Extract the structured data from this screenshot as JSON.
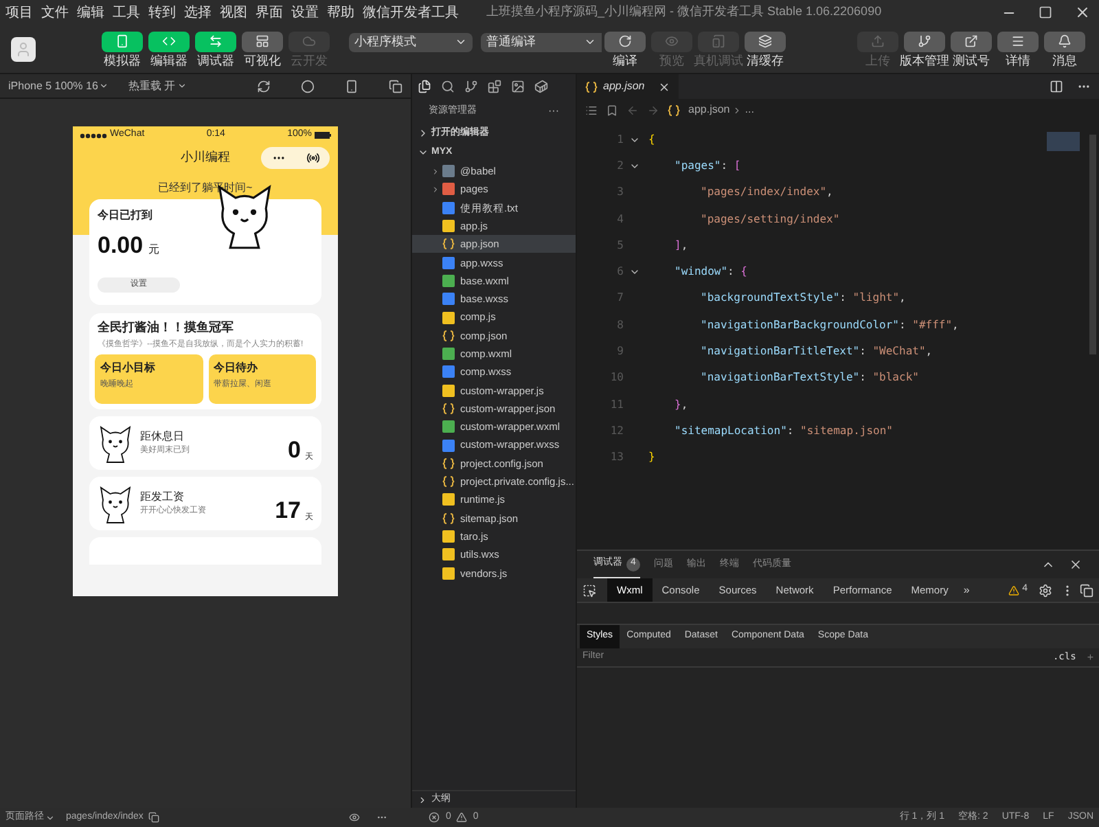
{
  "menu": [
    "项目",
    "文件",
    "编辑",
    "工具",
    "转到",
    "选择",
    "视图",
    "界面",
    "设置",
    "帮助",
    "微信开发者工具"
  ],
  "window": {
    "title": "上班摸鱼小程序源码_小川编程网 - 微信开发者工具 Stable 1.06.2206090"
  },
  "toolbar": {
    "view_buttons": [
      {
        "kind": "phone",
        "label": "模拟器",
        "selected": true,
        "disabled": false
      },
      {
        "kind": "code",
        "label": "编辑器",
        "selected": true,
        "disabled": false
      },
      {
        "kind": "debug",
        "label": "调试器",
        "selected": true,
        "disabled": false
      },
      {
        "kind": "layout",
        "label": "可视化",
        "selected": false,
        "disabled": false
      },
      {
        "kind": "cloud",
        "label": "云开发",
        "selected": false,
        "disabled": true
      }
    ],
    "mode_select": "小程序模式",
    "compile_select": "普通编译",
    "compile_buttons": [
      {
        "kind": "refresh",
        "label": "编译",
        "disabled": false
      },
      {
        "kind": "eye",
        "label": "预览",
        "disabled": true
      },
      {
        "kind": "device",
        "label": "真机调试",
        "disabled": true
      },
      {
        "kind": "layers",
        "label": "清缓存",
        "disabled": false
      }
    ],
    "right_buttons": [
      {
        "kind": "upload",
        "label": "上传",
        "disabled": true
      },
      {
        "kind": "branch",
        "label": "版本管理",
        "disabled": false
      },
      {
        "kind": "external",
        "label": "测试号",
        "disabled": false
      },
      {
        "kind": "menu",
        "label": "详情",
        "disabled": false
      },
      {
        "kind": "bell",
        "label": "消息",
        "disabled": false
      }
    ]
  },
  "simulator": {
    "device": "iPhone 5 100% 16",
    "hot_reload": "热重载 开",
    "phone": {
      "carrier": "WeChat",
      "time": "0:14",
      "battery": "100%",
      "nav_title": "小川编程",
      "banner": "已经到了躺平时间~",
      "earnings": {
        "title": "今日已打到",
        "amount": "0.00",
        "unit": "元",
        "button": "设置"
      },
      "motto": {
        "title": "全民打酱油！！摸鱼冠军",
        "quote": "《摸鱼哲学》--摸鱼不是自我放纵，而是个人实力的积蓄!"
      },
      "goals": [
        {
          "title": "今日小目标",
          "text": "晚睡晚起"
        },
        {
          "title": "今日待办",
          "text": "带薪拉屎、闲逛"
        }
      ],
      "countdowns": [
        {
          "title": "距休息日",
          "subtitle": "美好周末已到",
          "value": "0",
          "unit": "天"
        },
        {
          "title": "距发工资",
          "subtitle": "开开心心快发工资",
          "value": "17",
          "unit": "天"
        }
      ]
    }
  },
  "explorer": {
    "title": "资源管理器",
    "more": "···",
    "sections": [
      {
        "label": "打开的编辑器",
        "expanded": false
      },
      {
        "label": "MYX",
        "expanded": true
      }
    ],
    "files": [
      {
        "kind": "folder",
        "name": "@babel",
        "selected": false
      },
      {
        "kind": "pages",
        "name": "pages",
        "selected": false
      },
      {
        "kind": "txt",
        "name": "使用教程.txt",
        "selected": false
      },
      {
        "kind": "js",
        "name": "app.js",
        "selected": false
      },
      {
        "kind": "json",
        "name": "app.json",
        "selected": true
      },
      {
        "kind": "wxss",
        "name": "app.wxss",
        "selected": false
      },
      {
        "kind": "wxml",
        "name": "base.wxml",
        "selected": false
      },
      {
        "kind": "wxss",
        "name": "base.wxss",
        "selected": false
      },
      {
        "kind": "js",
        "name": "comp.js",
        "selected": false
      },
      {
        "kind": "json",
        "name": "comp.json",
        "selected": false
      },
      {
        "kind": "wxml",
        "name": "comp.wxml",
        "selected": false
      },
      {
        "kind": "wxss",
        "name": "comp.wxss",
        "selected": false
      },
      {
        "kind": "js",
        "name": "custom-wrapper.js",
        "selected": false
      },
      {
        "kind": "json",
        "name": "custom-wrapper.json",
        "selected": false
      },
      {
        "kind": "wxml",
        "name": "custom-wrapper.wxml",
        "selected": false
      },
      {
        "kind": "wxss",
        "name": "custom-wrapper.wxss",
        "selected": false
      },
      {
        "kind": "json",
        "name": "project.config.json",
        "selected": false
      },
      {
        "kind": "json",
        "name": "project.private.config.js...",
        "selected": false
      },
      {
        "kind": "js",
        "name": "runtime.js",
        "selected": false
      },
      {
        "kind": "json",
        "name": "sitemap.json",
        "selected": false
      },
      {
        "kind": "js",
        "name": "taro.js",
        "selected": false
      },
      {
        "kind": "js",
        "name": "utils.wxs",
        "selected": false
      },
      {
        "kind": "js",
        "name": "vendors.js",
        "selected": false
      }
    ],
    "outline": "大纲"
  },
  "editor": {
    "tab": "app.json",
    "breadcrumb": [
      "app.json",
      "..."
    ],
    "lines": [
      {
        "number": "1",
        "tokens": [
          {
            "kind": "brace",
            "text": "{"
          }
        ],
        "children": [
          {
            "number": "2",
            "tokens": [
              {
                "kind": "key",
                "text": "\"pages\""
              },
              {
                "kind": "punct",
                "text": ": "
              },
              {
                "kind": "bracket",
                "text": "["
              }
            ],
            "children": [
              {
                "number": "3",
                "tokens": [
                  {
                    "kind": "string",
                    "text": "\"pages/index/index\""
                  },
                  {
                    "kind": "punct",
                    "text": ","
                  }
                ]
              },
              {
                "number": "4",
                "tokens": [
                  {
                    "kind": "string",
                    "text": "\"pages/setting/index\""
                  }
                ]
              }
            ]
          },
          {
            "number": "5",
            "tokens": [
              {
                "kind": "bracket",
                "text": "]"
              },
              {
                "kind": "punct",
                "text": ","
              }
            ]
          },
          {
            "number": "6",
            "tokens": [
              {
                "kind": "key",
                "text": "\"window\""
              },
              {
                "kind": "punct",
                "text": ": "
              },
              {
                "kind": "bracket",
                "text": "{"
              }
            ],
            "children": [
              {
                "number": "7",
                "tokens": [
                  {
                    "kind": "key",
                    "text": "\"backgroundTextStyle\""
                  },
                  {
                    "kind": "punct",
                    "text": ": "
                  },
                  {
                    "kind": "string",
                    "text": "\"light\""
                  },
                  {
                    "kind": "punct",
                    "text": ","
                  }
                ]
              },
              {
                "number": "8",
                "tokens": [
                  {
                    "kind": "key",
                    "text": "\"navigationBarBackgroundColor\""
                  },
                  {
                    "kind": "punct",
                    "text": ": "
                  },
                  {
                    "kind": "string",
                    "text": "\"#fff\""
                  },
                  {
                    "kind": "punct",
                    "text": ","
                  }
                ]
              },
              {
                "number": "9",
                "tokens": [
                  {
                    "kind": "key",
                    "text": "\"navigationBarTitleText\""
                  },
                  {
                    "kind": "punct",
                    "text": ": "
                  },
                  {
                    "kind": "string",
                    "text": "\"WeChat\""
                  },
                  {
                    "kind": "punct",
                    "text": ","
                  }
                ]
              },
              {
                "number": "10",
                "tokens": [
                  {
                    "kind": "key",
                    "text": "\"navigationBarTextStyle\""
                  },
                  {
                    "kind": "punct",
                    "text": ": "
                  },
                  {
                    "kind": "string",
                    "text": "\"black\""
                  }
                ]
              }
            ]
          },
          {
            "number": "11",
            "tokens": [
              {
                "kind": "bracket",
                "text": "}"
              },
              {
                "kind": "punct",
                "text": ","
              }
            ]
          },
          {
            "number": "12",
            "tokens": [
              {
                "kind": "key",
                "text": "\"sitemapLocation\""
              },
              {
                "kind": "punct",
                "text": ": "
              },
              {
                "kind": "string",
                "text": "\"sitemap.json\""
              }
            ]
          }
        ]
      },
      {
        "number": "13",
        "tokens": [
          {
            "kind": "brace",
            "text": "}"
          }
        ]
      }
    ]
  },
  "devtools": {
    "panel_tabs": [
      {
        "label": "调试器",
        "badge": "4",
        "selected": true
      },
      {
        "label": "问题",
        "selected": false
      },
      {
        "label": "输出",
        "selected": false
      },
      {
        "label": "终端",
        "selected": false
      },
      {
        "label": "代码质量",
        "selected": false
      }
    ],
    "tabs": [
      {
        "label": "Wxml",
        "selected": true
      },
      {
        "label": "Console",
        "selected": false
      },
      {
        "label": "Sources",
        "selected": false
      },
      {
        "label": "Network",
        "selected": false
      },
      {
        "label": "Performance",
        "selected": false
      },
      {
        "label": "Memory",
        "selected": false
      }
    ],
    "overflow": "»",
    "warnings": "4",
    "style_tabs": [
      {
        "label": "Styles",
        "selected": true
      },
      {
        "label": "Computed",
        "selected": false
      },
      {
        "label": "Dataset",
        "selected": false
      },
      {
        "label": "Component Data",
        "selected": false
      },
      {
        "label": "Scope Data",
        "selected": false
      }
    ],
    "filter": {
      "placeholder": "Filter"
    },
    "cls": ".cls",
    "add": "+"
  },
  "status_bar": {
    "page_path_label": "页面路径",
    "page_path": "pages/index/index",
    "errors": "0",
    "warnings": "0",
    "position": "行 1，列 1",
    "spaces": "空格: 2",
    "encoding": "UTF-8",
    "eol": "LF",
    "language": "JSON"
  }
}
